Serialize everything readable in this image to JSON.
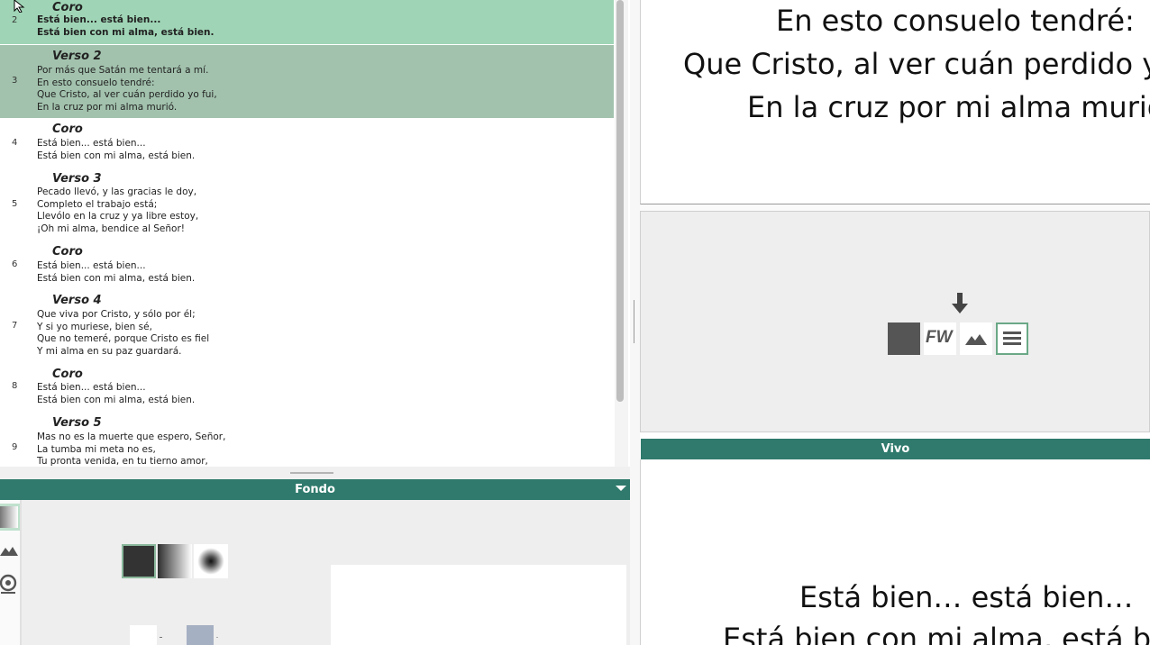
{
  "song_list": {
    "items": [
      {
        "num": "2",
        "label": "Coro",
        "lines": [
          "Está bien... está bien...",
          "Está bien con mi alma, está bien."
        ],
        "state": "live"
      },
      {
        "num": "3",
        "label": "Verso 2",
        "lines": [
          "Por más que Satán me tentará a mí.",
          "En esto consuelo tendré:",
          "Que Cristo, al ver cuán perdido yo fui,",
          "En la cruz por mi alma murió."
        ],
        "state": "preview"
      },
      {
        "num": "4",
        "label": "Coro",
        "lines": [
          "Está bien... está bien...",
          "Está bien con mi alma, está bien."
        ],
        "state": "normal"
      },
      {
        "num": "5",
        "label": "Verso 3",
        "lines": [
          "Pecado llevó, y las gracias le doy,",
          "Completo el trabajo está;",
          "Llevólo en la cruz y ya libre estoy,",
          "¡Oh mi alma, bendice al Señor!"
        ],
        "state": "normal"
      },
      {
        "num": "6",
        "label": "Coro",
        "lines": [
          "Está bien... está bien...",
          "Está bien con mi alma, está bien."
        ],
        "state": "normal"
      },
      {
        "num": "7",
        "label": "Verso 4",
        "lines": [
          "Que viva por Cristo, y sólo por él;",
          "Y si yo muriese, bien sé,",
          "Que no temeré, porque Cristo es fiel",
          "Y mi alma en su paz guardará."
        ],
        "state": "normal"
      },
      {
        "num": "8",
        "label": "Coro",
        "lines": [
          "Está bien... está bien...",
          "Está bien con mi alma, está bien."
        ],
        "state": "normal"
      },
      {
        "num": "9",
        "label": "Verso 5",
        "lines": [
          "Mas no es la muerte que espero, Señor,",
          "La tumba mi meta no es,",
          "Tu pronta venida, en tu tierno amor,"
        ],
        "state": "normal"
      }
    ]
  },
  "fondo_panel": {
    "title": "Fondo",
    "sidebar": [
      "gradient-icon",
      "image-icon",
      "webcam-icon"
    ],
    "swatches": [
      "solid",
      "linear-gradient",
      "radial-gradient"
    ]
  },
  "preview": {
    "lines": [
      "En esto consuelo tendré:",
      "Que Cristo, al ver cuán perdido yo fui,",
      "En la cruz por mi alma murió."
    ]
  },
  "layers": {
    "buttons": [
      {
        "icon": "solid-color-icon"
      },
      {
        "icon": "fw-icon",
        "text": "FW"
      },
      {
        "icon": "mountain-icon"
      },
      {
        "icon": "menu-icon"
      }
    ]
  },
  "live": {
    "title": "Vivo",
    "lines": [
      "Está bien… está bien…",
      "Está bien con mi alma, está bien."
    ]
  },
  "colors": {
    "accent": "#2f7a6c",
    "live_row": "#9fd5b6",
    "preview_row": "#a2c2ad"
  }
}
